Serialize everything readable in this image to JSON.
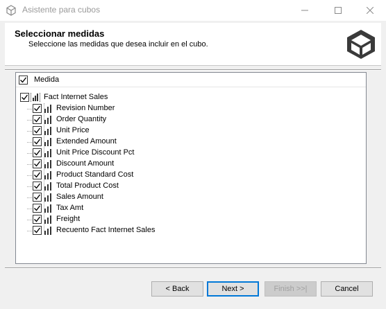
{
  "window": {
    "title": "Asistente para cubos",
    "minimize_glyph": "—",
    "maximize_glyph": "☐",
    "close_glyph": "✕"
  },
  "header": {
    "title": "Seleccionar medidas",
    "subtitle": "Seleccione las medidas que desea incluir en el cubo.",
    "logo_icon": "cube-icon"
  },
  "tree": {
    "column_header": "Medida",
    "column_checked": true,
    "group": {
      "label": "Fact Internet Sales",
      "checked": true,
      "icon": "measure-group-icon"
    },
    "measures": [
      {
        "label": "Revision Number",
        "checked": true
      },
      {
        "label": "Order Quantity",
        "checked": true
      },
      {
        "label": "Unit Price",
        "checked": true
      },
      {
        "label": "Extended Amount",
        "checked": true
      },
      {
        "label": "Unit Price Discount Pct",
        "checked": true
      },
      {
        "label": "Discount Amount",
        "checked": true
      },
      {
        "label": "Product Standard Cost",
        "checked": true
      },
      {
        "label": "Total Product Cost",
        "checked": true
      },
      {
        "label": "Sales Amount",
        "checked": true
      },
      {
        "label": "Tax Amt",
        "checked": true
      },
      {
        "label": "Freight",
        "checked": true
      },
      {
        "label": "Recuento Fact Internet Sales",
        "checked": true
      }
    ]
  },
  "buttons": {
    "back": "< Back",
    "next": "Next >",
    "finish": "Finish >>|",
    "cancel": "Cancel"
  }
}
